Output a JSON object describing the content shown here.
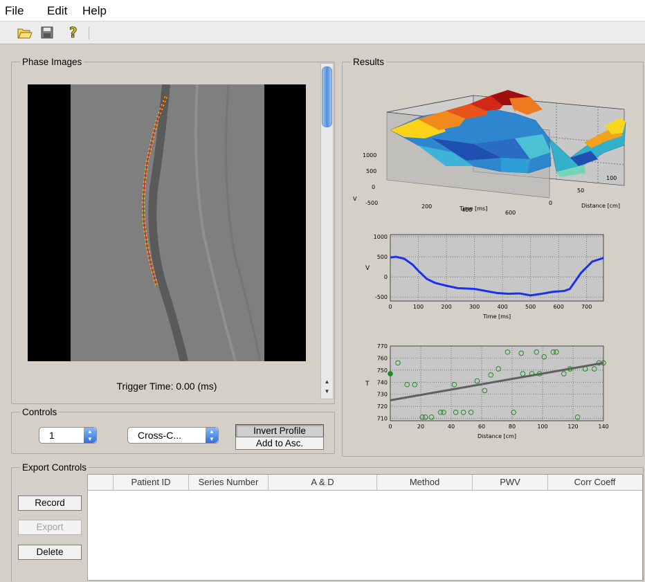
{
  "menu": [
    "File",
    "Edit",
    "Help"
  ],
  "toolbar": {
    "open_icon": "folder-open-icon",
    "save_icon": "floppy-disk-icon",
    "help_icon": "help-icon"
  },
  "phase": {
    "title": "Phase Images",
    "trigger": "Trigger Time: 0.00 (ms)"
  },
  "results": {
    "title": "Results"
  },
  "controls": {
    "title": "Controls",
    "frame_value": "1",
    "method_value": "Cross-C...",
    "invert_label": "Invert Profile",
    "add_label": "Add to Asc."
  },
  "export": {
    "title": "Export Controls",
    "record_label": "Record",
    "export_label": "Export",
    "delete_label": "Delete",
    "columns": [
      "",
      "Patient ID",
      "Series Number",
      "A & D",
      "Method",
      "PWV",
      "Corr Coeff"
    ]
  },
  "colors": {
    "velocity_line": "#1a2ff0",
    "scatter_point": "#1f8a1f",
    "fit_line": "#606060"
  },
  "chart_data": [
    {
      "type": "surface",
      "ylabel": "V",
      "xlabel": "Time [ms]",
      "zlabel": "Distance [cm]",
      "y_ticks": [
        1000,
        500,
        0,
        -500
      ],
      "x_ticks": [
        200,
        400,
        600
      ],
      "z_ticks": [
        0,
        50,
        100
      ]
    },
    {
      "type": "line",
      "xlabel": "Time [ms]",
      "ylabel": "V",
      "xlim": [
        0,
        760
      ],
      "ylim": [
        -600,
        1050
      ],
      "x_ticks": [
        0,
        100,
        200,
        300,
        400,
        500,
        600,
        700
      ],
      "y_ticks": [
        -500,
        0,
        500,
        1000
      ],
      "grid": true,
      "x": [
        0,
        20,
        50,
        80,
        100,
        130,
        160,
        200,
        240,
        300,
        340,
        380,
        420,
        460,
        500,
        540,
        580,
        620,
        640,
        680,
        720,
        760
      ],
      "y": [
        480,
        500,
        450,
        300,
        150,
        -50,
        -150,
        -220,
        -280,
        -300,
        -350,
        -400,
        -420,
        -410,
        -460,
        -420,
        -370,
        -350,
        -300,
        100,
        380,
        470
      ]
    },
    {
      "type": "scatter",
      "xlabel": "Distance [cm]",
      "ylabel": "T",
      "xlim": [
        0,
        140
      ],
      "ylim": [
        708,
        770
      ],
      "x_ticks": [
        0,
        20,
        40,
        60,
        80,
        100,
        120,
        140
      ],
      "y_ticks": [
        710,
        720,
        730,
        740,
        750,
        760,
        770
      ],
      "grid": true,
      "x": [
        0,
        5,
        11,
        16,
        21,
        23,
        27,
        33,
        35,
        42,
        43,
        48,
        53,
        57,
        62,
        66,
        71,
        77,
        81,
        86,
        87,
        93,
        96,
        98,
        101,
        107,
        109,
        114,
        118,
        123,
        128,
        134,
        137,
        140
      ],
      "y": [
        747,
        756,
        738,
        738,
        711,
        711,
        711,
        715,
        715,
        738,
        715,
        715,
        715,
        741,
        733,
        746,
        751,
        765,
        715,
        764,
        747,
        747,
        765,
        747,
        761,
        765,
        765,
        747,
        751,
        711,
        751,
        751,
        756,
        756
      ],
      "fit": {
        "x": [
          0,
          140
        ],
        "y": [
          725,
          756
        ]
      }
    }
  ]
}
